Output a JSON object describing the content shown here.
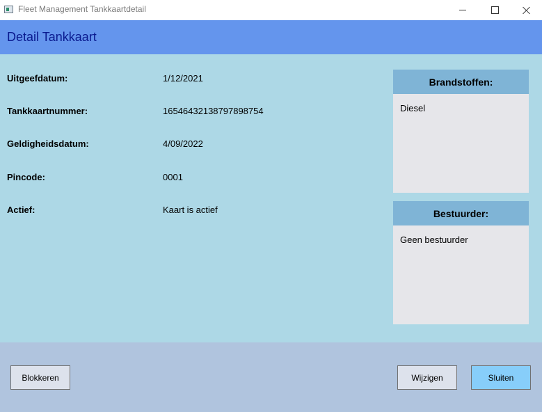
{
  "window": {
    "title": "Fleet Management Tankkaartdetail"
  },
  "header": {
    "title": "Detail Tankkaart"
  },
  "fields": [
    {
      "label": "Uitgeefdatum:",
      "value": "1/12/2021"
    },
    {
      "label": "Tankkaartnummer:",
      "value": "16546432138797898754"
    },
    {
      "label": "Geldigheidsdatum:",
      "value": "4/09/2022"
    },
    {
      "label": "Pincode:",
      "value": "0001"
    },
    {
      "label": "Actief:",
      "value": "Kaart is actief"
    }
  ],
  "panels": {
    "brandstoffen": {
      "title": "Brandstoffen:",
      "items": [
        "Diesel"
      ]
    },
    "bestuurder": {
      "title": "Bestuurder:",
      "items": [
        "Geen bestuurder"
      ]
    }
  },
  "buttons": {
    "blokkeren": "Blokkeren",
    "wijzigen": "Wijzigen",
    "sluiten": "Sluiten"
  },
  "colors": {
    "header_bg": "#6495ed",
    "header_text": "#0a1a8f",
    "content_bg": "#add8e6",
    "footer_bg": "#b0c4de",
    "panel_header": "#7fb4d6",
    "panel_body": "#e6e6ea",
    "primary_button": "#87cefa"
  }
}
